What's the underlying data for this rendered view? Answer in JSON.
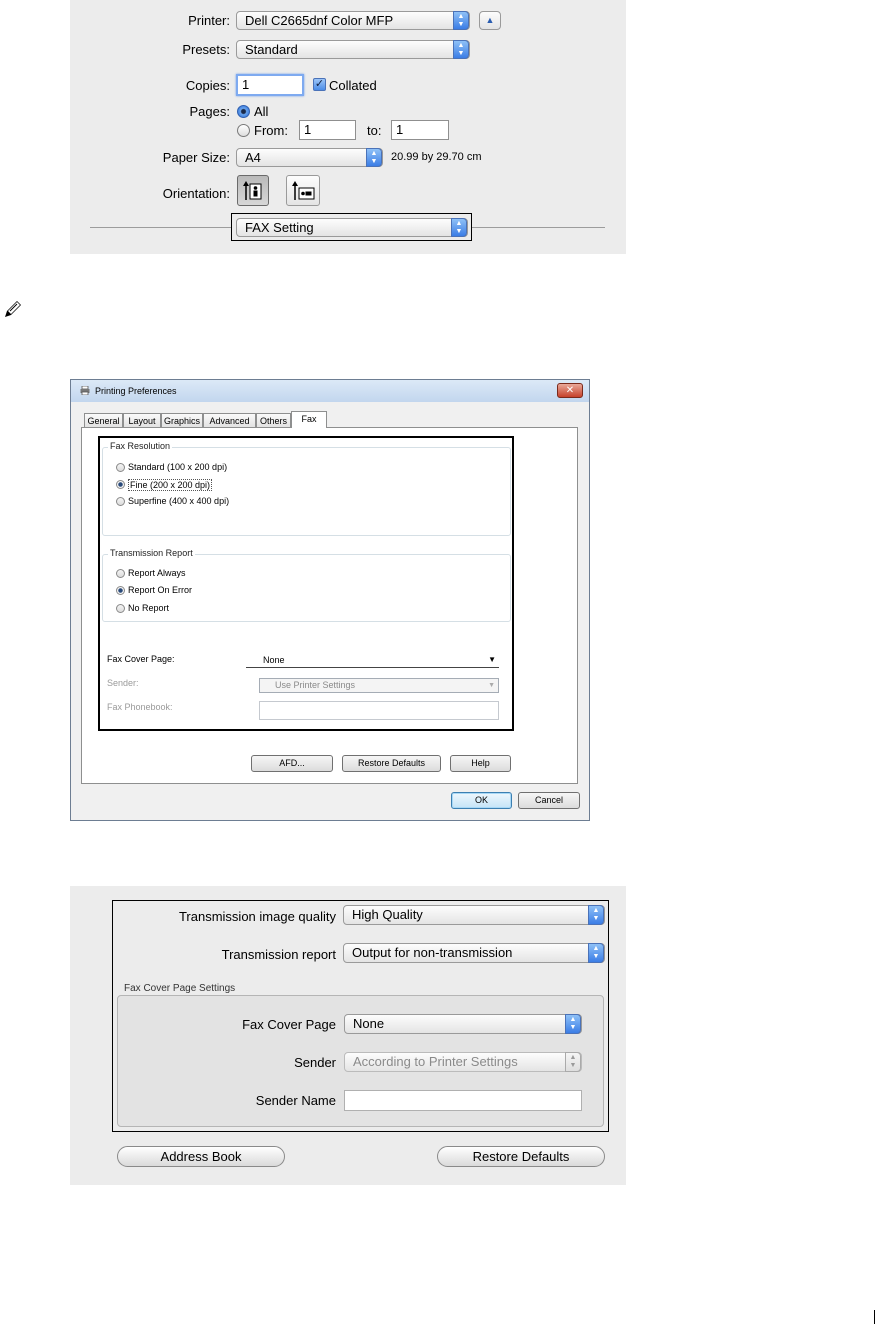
{
  "mac_print": {
    "printer_label": "Printer:",
    "printer_value": "Dell C2665dnf Color MFP",
    "presets_label": "Presets:",
    "presets_value": "Standard",
    "copies_label": "Copies:",
    "copies_value": "1",
    "collated_label": "Collated",
    "pages_label": "Pages:",
    "all_label": "All",
    "from_label": "From:",
    "from_value": "1",
    "to_label": "to:",
    "to_value": "1",
    "paper_size_label": "Paper Size:",
    "paper_size_value": "A4",
    "paper_dimensions": "20.99 by 29.70 cm",
    "orientation_label": "Orientation:",
    "section_value": "FAX Setting"
  },
  "win_dialog": {
    "title": "Printing Preferences",
    "tabs": [
      "General",
      "Layout",
      "Graphics",
      "Advanced",
      "Others",
      "Fax"
    ],
    "resolution_group": "Fax Resolution",
    "resolution_options": [
      "Standard (100 x 200 dpi)",
      "Fine (200 x 200 dpi)",
      "Superfine (400 x 400 dpi)"
    ],
    "report_group": "Transmission Report",
    "report_options": [
      "Report Always",
      "Report On Error",
      "No Report"
    ],
    "cover_page_label": "Fax Cover Page:",
    "cover_page_value": "None",
    "sender_label": "Sender:",
    "sender_value": "Use Printer Settings",
    "phonebook_label": "Fax Phonebook:",
    "afd_button": "AFD...",
    "restore_button": "Restore Defaults",
    "help_button": "Help",
    "ok_button": "OK",
    "cancel_button": "Cancel"
  },
  "mac_fax": {
    "quality_label": "Transmission image quality",
    "quality_value": "High Quality",
    "report_label": "Transmission report",
    "report_value": "Output for non-transmission",
    "cover_group": "Fax Cover Page Settings",
    "cover_label": "Fax Cover Page",
    "cover_value": "None",
    "sender_label": "Sender",
    "sender_value": "According to Printer Settings",
    "sender_name_label": "Sender Name",
    "sender_name_value": "",
    "address_book_button": "Address Book",
    "restore_button": "Restore Defaults"
  },
  "icons": {
    "note": "note-pencil-icon",
    "printer": "printer-icon",
    "portrait": "portrait-orientation-icon",
    "landscape": "landscape-orientation-icon"
  }
}
